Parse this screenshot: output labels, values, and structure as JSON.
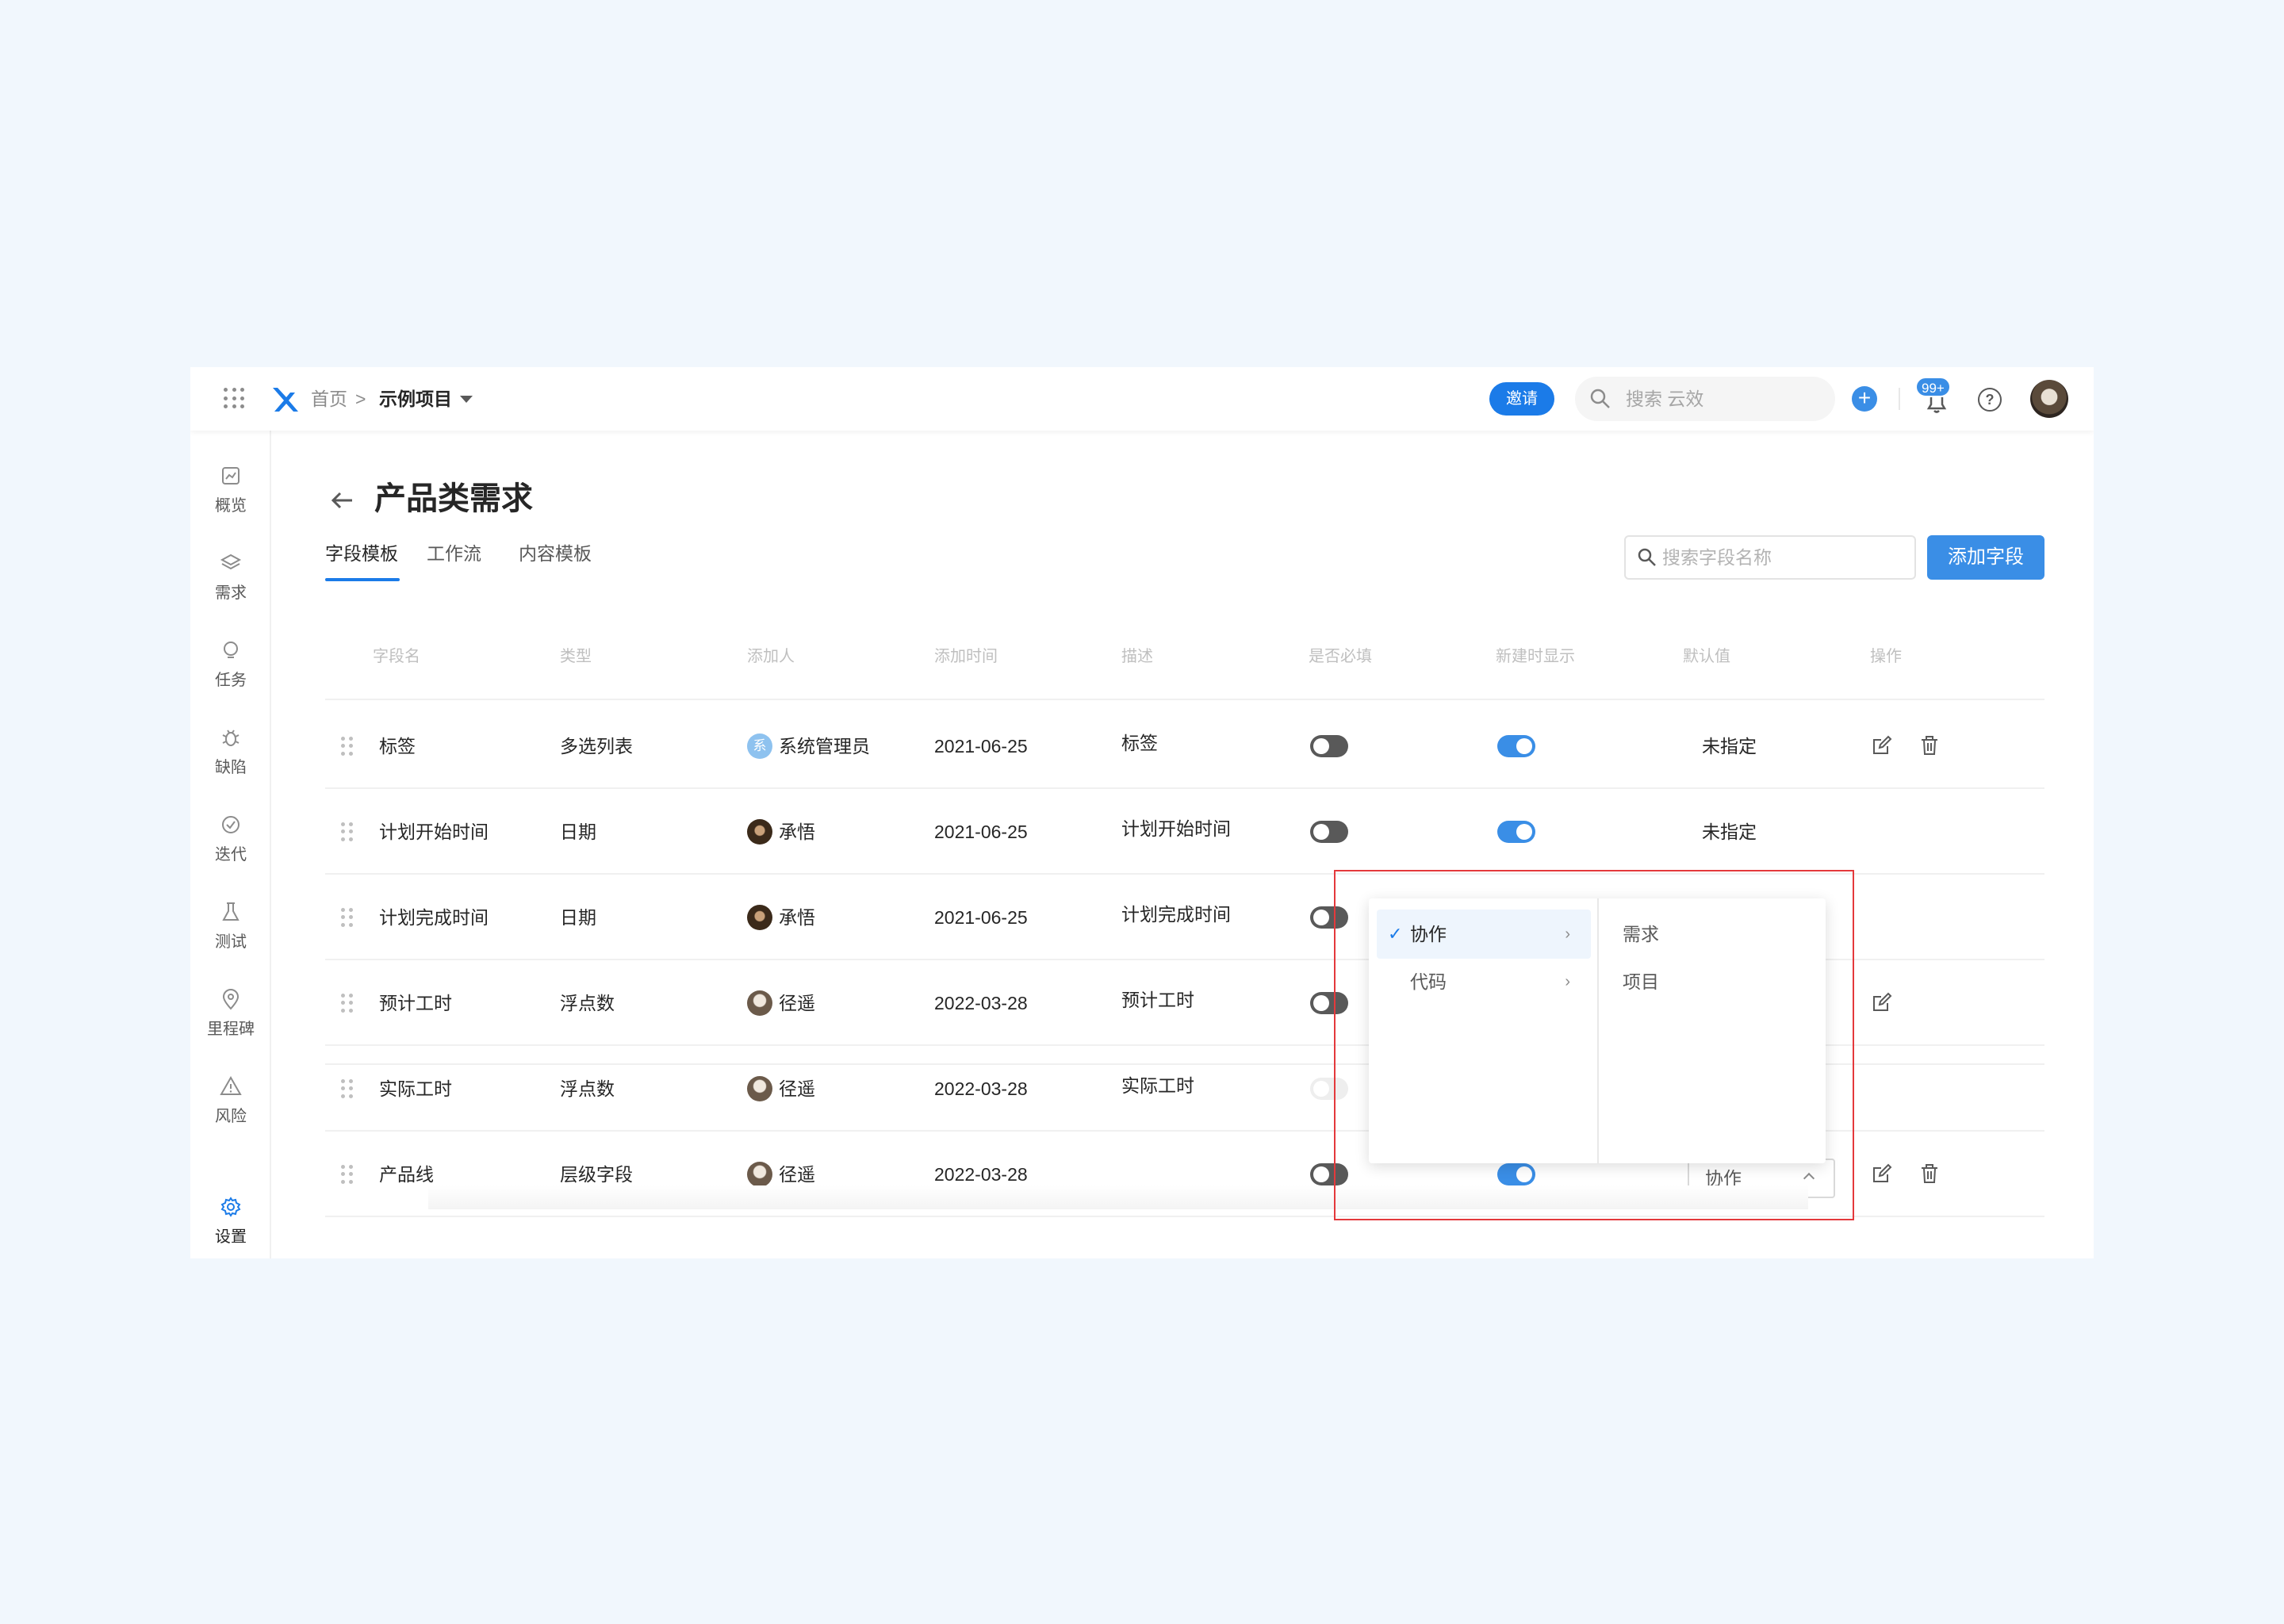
{
  "topbar": {
    "breadcrumb_home": "首页",
    "breadcrumb_sep": ">",
    "project_name": "示例项目",
    "invite_label": "邀请",
    "search_placeholder": "搜索 云效",
    "notification_count": "99+",
    "help_label": "?"
  },
  "sidebar": {
    "items": [
      {
        "label": "概览",
        "icon": "chart-icon"
      },
      {
        "label": "需求",
        "icon": "layers-icon"
      },
      {
        "label": "任务",
        "icon": "bulb-icon"
      },
      {
        "label": "缺陷",
        "icon": "bug-icon"
      },
      {
        "label": "迭代",
        "icon": "cycle-icon"
      },
      {
        "label": "测试",
        "icon": "flask-icon"
      },
      {
        "label": "里程碑",
        "icon": "pin-icon"
      },
      {
        "label": "风险",
        "icon": "warning-icon"
      },
      {
        "label": "设置",
        "icon": "gear-icon"
      }
    ]
  },
  "page": {
    "title": "产品类需求",
    "tabs": [
      "字段模板",
      "工作流",
      "内容模板"
    ],
    "active_tab": "字段模板",
    "field_search_placeholder": "搜索字段名称",
    "add_field_label": "添加字段"
  },
  "table": {
    "headers": [
      "字段名",
      "类型",
      "添加人",
      "添加时间",
      "描述",
      "是否必填",
      "新建时显示",
      "默认值",
      "操作"
    ],
    "rows": [
      {
        "name": "标签",
        "type": "多选列表",
        "adder": "系统管理员",
        "avatar_text": "系",
        "date": "2021-06-25",
        "desc": "标签",
        "required": false,
        "show_on_create": true,
        "default": "未指定"
      },
      {
        "name": "计划开始时间",
        "type": "日期",
        "adder": "承悟",
        "date": "2021-06-25",
        "desc": "计划开始时间",
        "required": false,
        "show_on_create": true,
        "default": "未指定"
      },
      {
        "name": "计划完成时间",
        "type": "日期",
        "adder": "承悟",
        "date": "2021-06-25",
        "desc": "计划完成时间",
        "required": false
      },
      {
        "name": "预计工时",
        "type": "浮点数",
        "adder": "径遥",
        "date": "2022-03-28",
        "desc": "预计工时",
        "required": false
      },
      {
        "name": "实际工时",
        "type": "浮点数",
        "adder": "径遥",
        "date": "2022-03-28",
        "desc": "实际工时"
      },
      {
        "name": "产品线",
        "type": "层级字段",
        "adder": "径遥",
        "date": "2022-03-28",
        "desc": "",
        "required": false,
        "show_on_create": true,
        "default": "协作"
      }
    ]
  },
  "cascader": {
    "level1": [
      {
        "label": "协作",
        "selected": true
      },
      {
        "label": "代码",
        "selected": false
      }
    ],
    "level2": [
      "需求",
      "项目"
    ]
  },
  "colors": {
    "accent": "#3a8ee6",
    "highlight_border": "#e4393c"
  }
}
